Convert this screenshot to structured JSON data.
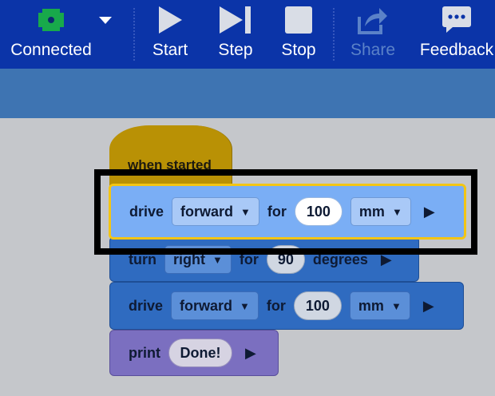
{
  "toolbar": {
    "device": {
      "label": "Connected",
      "icon": "device-icon",
      "status_color": "#18a94b"
    },
    "start_label": "Start",
    "step_label": "Step",
    "stop_label": "Stop",
    "share_label": "Share",
    "feedback_label": "Feedback"
  },
  "blocks": {
    "hat": {
      "label": "when started"
    },
    "drive1": {
      "label": "drive",
      "direction": "forward",
      "for_label": "for",
      "distance": "100",
      "unit": "mm"
    },
    "turn": {
      "label": "turn",
      "direction": "right",
      "for_label": "for",
      "angle": "90",
      "unit": "degrees"
    },
    "drive2": {
      "label": "drive",
      "direction": "forward",
      "for_label": "for",
      "distance": "100",
      "unit": "mm"
    },
    "print": {
      "label": "print",
      "text": "Done!"
    }
  },
  "colors": {
    "toolbar": "#0b34a8",
    "subbar": "#3e74b2",
    "motion": "#2f6bc0",
    "selected_motion": "#7aaef5",
    "selection_outline": "#f3c514",
    "events": "#b99105",
    "looks": "#7b6fc0"
  }
}
